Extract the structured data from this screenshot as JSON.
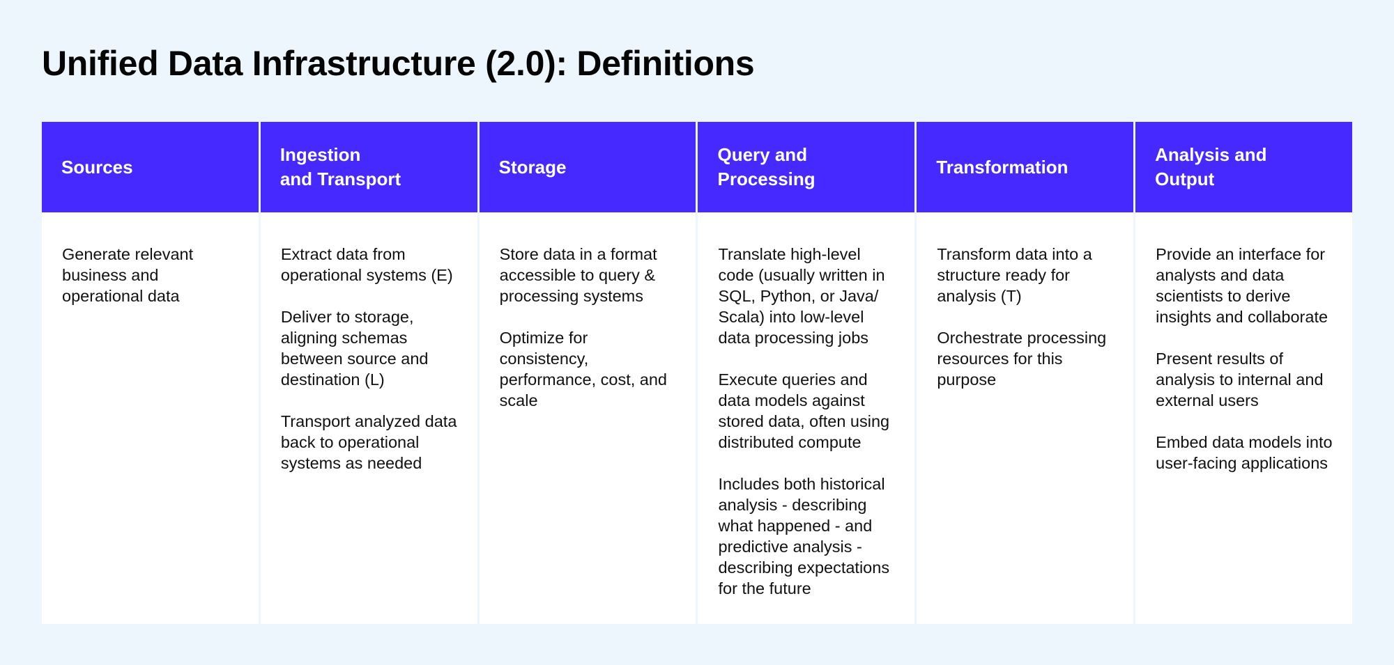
{
  "page": {
    "title": "Unified Data Infrastructure (2.0): Definitions"
  },
  "colors": {
    "header_background": "#4629ff",
    "header_text": "#ffffff",
    "page_background": "#eef6fd",
    "cell_background": "#ffffff"
  },
  "columns": [
    {
      "heading": "Sources",
      "paragraphs": [
        "Generate relevant business and operational data"
      ]
    },
    {
      "heading": "Ingestion\nand Transport",
      "paragraphs": [
        "Extract data from operational systems (E)",
        "Deliver to storage, aligning schemas between source and destination (L)",
        "Transport analyzed data back to operational systems as needed"
      ]
    },
    {
      "heading": "Storage",
      "paragraphs": [
        "Store data in a format accessible to query & processing systems",
        "Optimize for consistency, performance, cost, and scale"
      ]
    },
    {
      "heading": "Query and\nProcessing",
      "paragraphs": [
        "Translate high-level code (usually written in SQL, Python, or Java/ Scala) into low-level data processing jobs",
        "Execute queries and data models against stored data, often using distributed compute",
        "Includes both historical analysis - describing what happened - and predictive analysis - describing expectations for the future"
      ]
    },
    {
      "heading": "Transformation",
      "paragraphs": [
        "Transform data into a structure ready for analysis (T)",
        "Orchestrate processing resources for this purpose"
      ]
    },
    {
      "heading": "Analysis and\nOutput",
      "paragraphs": [
        "Provide an interface for analysts and data scientists to derive insights and collaborate",
        "Present results of analysis to internal and external users",
        "Embed data models into user-facing applications"
      ]
    }
  ]
}
